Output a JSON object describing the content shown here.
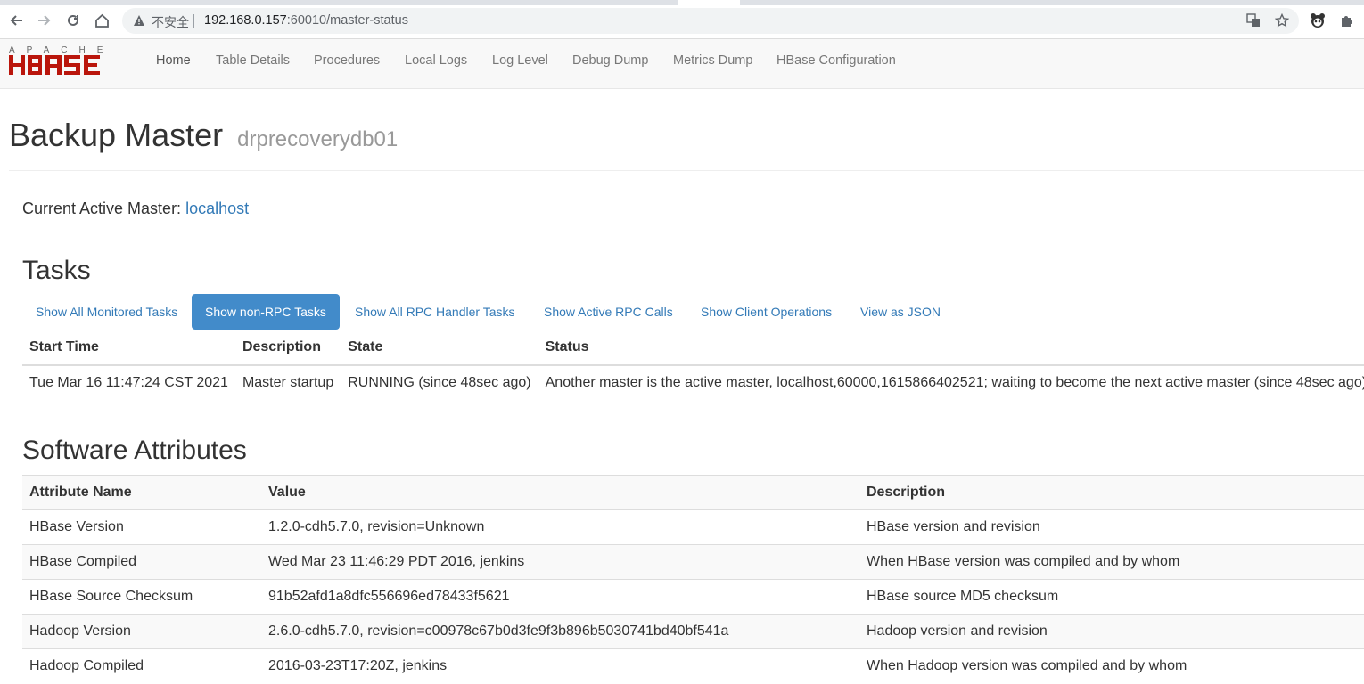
{
  "browser": {
    "insecure_label": "不安全",
    "url_host": "192.168.0.157",
    "url_path": ":60010/master-status"
  },
  "navbar": {
    "logo_text": "APACHE HBASE",
    "items": [
      {
        "label": "Home"
      },
      {
        "label": "Table Details"
      },
      {
        "label": "Procedures"
      },
      {
        "label": "Local Logs"
      },
      {
        "label": "Log Level"
      },
      {
        "label": "Debug Dump"
      },
      {
        "label": "Metrics Dump"
      },
      {
        "label": "HBase Configuration"
      }
    ]
  },
  "page": {
    "title": "Backup Master",
    "hostname": "drprecoverydb01",
    "active_master_label": "Current Active Master:",
    "active_master_value": "localhost"
  },
  "tasks": {
    "title": "Tasks",
    "tabs": [
      {
        "label": "Show All Monitored Tasks"
      },
      {
        "label": "Show non-RPC Tasks"
      },
      {
        "label": "Show All RPC Handler Tasks"
      },
      {
        "label": "Show Active RPC Calls"
      },
      {
        "label": "Show Client Operations"
      },
      {
        "label": "View as JSON"
      }
    ],
    "columns": [
      "Start Time",
      "Description",
      "State",
      "Status"
    ],
    "rows": [
      {
        "start_time": "Tue Mar 16 11:47:24 CST 2021",
        "description": "Master startup",
        "state": "RUNNING (since 48sec ago)",
        "status": "Another master is the active master, localhost,60000,1615866402521; waiting to become the next active master (since 48sec ago)"
      }
    ]
  },
  "software": {
    "title": "Software Attributes",
    "columns": [
      "Attribute Name",
      "Value",
      "Description"
    ],
    "rows": [
      {
        "name": "HBase Version",
        "value": "1.2.0-cdh5.7.0, revision=Unknown",
        "description": "HBase version and revision"
      },
      {
        "name": "HBase Compiled",
        "value": "Wed Mar 23 11:46:29 PDT 2016, jenkins",
        "description": "When HBase version was compiled and by whom"
      },
      {
        "name": "HBase Source Checksum",
        "value": "91b52afd1a8dfc556696ed78433f5621",
        "description": "HBase source MD5 checksum"
      },
      {
        "name": "Hadoop Version",
        "value": "2.6.0-cdh5.7.0, revision=c00978c67b0d3fe9f3b896b5030741bd40bf541a",
        "description": "Hadoop version and revision"
      },
      {
        "name": "Hadoop Compiled",
        "value": "2016-03-23T17:20Z, jenkins",
        "description": "When Hadoop version was compiled and by whom"
      }
    ]
  },
  "colors": {
    "link": "#337ab7",
    "active_pill": "#428bca",
    "logo_red": "#ba160c"
  }
}
